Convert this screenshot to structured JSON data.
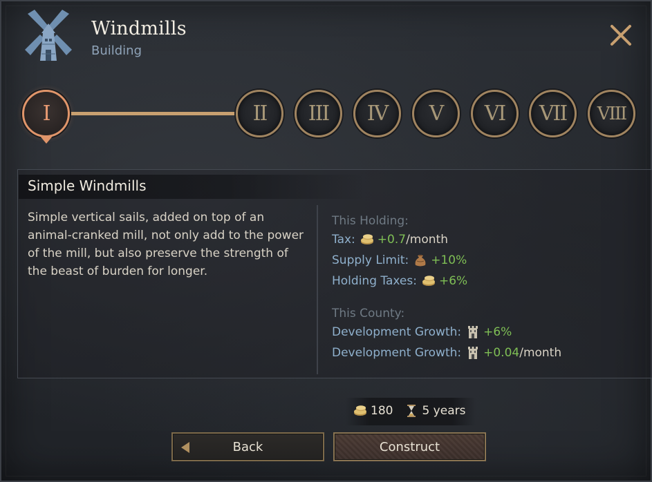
{
  "header": {
    "title": "Windmills",
    "subtitle": "Building",
    "icon": "windmill-icon",
    "close_icon": "close-icon"
  },
  "levels": {
    "items": [
      "I",
      "II",
      "III",
      "IV",
      "V",
      "VI",
      "VII",
      "VIII"
    ],
    "active_index": 0
  },
  "info": {
    "heading": "Simple Windmills",
    "description": "Simple vertical sails, added on top of an animal-cranked mill, not only add to the power of the mill, but also preserve the strength of the beast of burden for longer.",
    "holding_title": "This Holding:",
    "holding_effects": [
      {
        "label": "Tax:",
        "icon": "gold-coins-icon",
        "value": "+0.7",
        "unit": "/month"
      },
      {
        "label": "Supply Limit:",
        "icon": "supply-sack-icon",
        "value": "+10%",
        "unit": ""
      },
      {
        "label": "Holding Taxes:",
        "icon": "gold-coins-icon",
        "value": "+6%",
        "unit": ""
      }
    ],
    "county_title": "This County:",
    "county_effects": [
      {
        "label": "Development Growth:",
        "icon": "development-tower-icon",
        "value": "+6%",
        "unit": ""
      },
      {
        "label": "Development Growth:",
        "icon": "development-tower-icon",
        "value": "+0.04",
        "unit": "/month"
      }
    ]
  },
  "cost": {
    "gold": "180",
    "gold_icon": "gold-coins-icon",
    "time": "5 years",
    "time_icon": "hourglass-icon"
  },
  "buttons": {
    "back": "Back",
    "construct": "Construct"
  },
  "colors": {
    "accent": "#e0956a",
    "positive": "#7fbf55",
    "label_blue": "#8fb0cc",
    "muted": "#6f7a84"
  }
}
